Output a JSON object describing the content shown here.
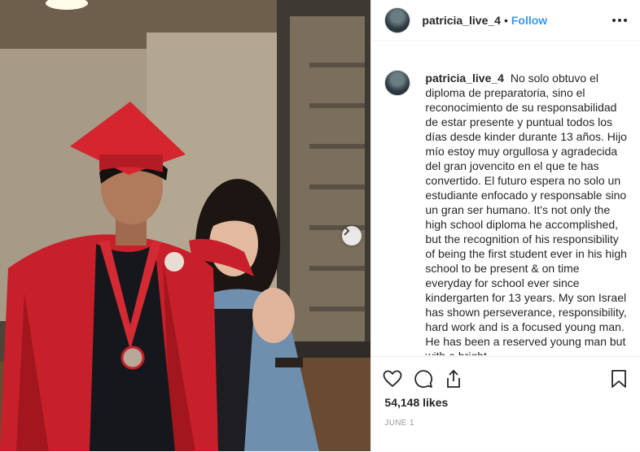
{
  "post": {
    "username": "patricia_live_4",
    "separator": "•",
    "follow_label": "Follow",
    "more_icon": "more-options-icon",
    "caption": "No solo obtuvo el diploma de preparatoria, sino el reconocimiento de su responsabilidad de estar presente y puntual todos los días desde kinder durante 13 años. Hijo mío estoy muy orgullosa y agradecida del gran jovencito en el que te has convertido. El futuro espera no solo un estudiante enfocado y responsable sino un gran ser humano. It's not only the high school diploma he accomplished, but the recognition of his responsibility of being the first student ever in his high school to be present & on time everyday for school ever since kindergarten for 13 years. My son Israel has shown perseverance, responsibility, hard work and is a focused young man. He has been a reserved young man but with a bright",
    "likes": "54,148 likes",
    "date": "JUNE 1"
  },
  "icons": {
    "like": "heart-icon",
    "comment": "comment-icon",
    "share": "share-icon",
    "save": "bookmark-icon",
    "next": "chevron-right-icon"
  },
  "colors": {
    "link": "#3897f0",
    "text": "#262626",
    "muted": "#999999",
    "gown": "#c8202a"
  }
}
